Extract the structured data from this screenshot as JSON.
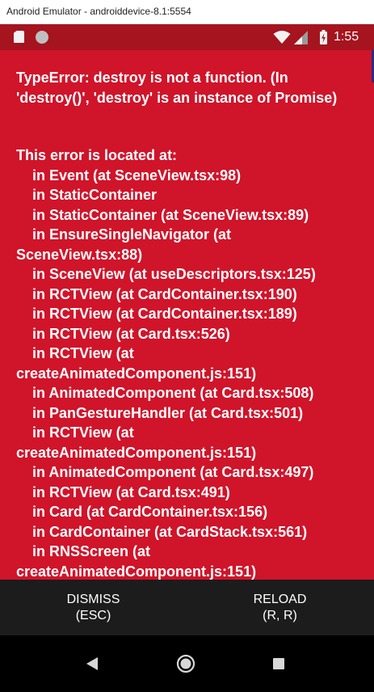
{
  "window": {
    "title": "Android Emulator - androiddevice-8.1:5554"
  },
  "status_bar": {
    "time": "1:55",
    "icons": [
      "sd-card-icon",
      "sync-dot-icon",
      "wifi-icon",
      "cell-signal-icon",
      "battery-charging-icon"
    ],
    "background_color": "#a5141f"
  },
  "redbox": {
    "background_color": "#d0142a",
    "error_message": "TypeError: destroy is not a function. (In 'destroy()', 'destroy' is an instance of Promise)",
    "stack_heading": "This error is located at:",
    "stack_lines": [
      {
        "text": "in Event (at SceneView.tsx:98)",
        "indent": true
      },
      {
        "text": "in StaticContainer",
        "indent": true
      },
      {
        "text": "in StaticContainer (at SceneView.tsx:89)",
        "indent": true
      },
      {
        "text": "in EnsureSingleNavigator (at",
        "indent": true
      },
      {
        "text": "SceneView.tsx:88)",
        "indent": false
      },
      {
        "text": "in SceneView (at useDescriptors.tsx:125)",
        "indent": true
      },
      {
        "text": "in RCTView (at CardContainer.tsx:190)",
        "indent": true
      },
      {
        "text": "in RCTView (at CardContainer.tsx:189)",
        "indent": true
      },
      {
        "text": "in RCTView (at Card.tsx:526)",
        "indent": true
      },
      {
        "text": "in RCTView (at",
        "indent": true
      },
      {
        "text": "createAnimatedComponent.js:151)",
        "indent": false
      },
      {
        "text": "in AnimatedComponent (at Card.tsx:508)",
        "indent": true
      },
      {
        "text": "in PanGestureHandler (at Card.tsx:501)",
        "indent": true
      },
      {
        "text": "in RCTView (at",
        "indent": true
      },
      {
        "text": "createAnimatedComponent.js:151)",
        "indent": false
      },
      {
        "text": "in AnimatedComponent (at Card.tsx:497)",
        "indent": true
      },
      {
        "text": "in RCTView (at Card.tsx:491)",
        "indent": true
      },
      {
        "text": "in Card (at CardContainer.tsx:156)",
        "indent": true
      },
      {
        "text": "in CardContainer (at CardStack.tsx:561)",
        "indent": true
      },
      {
        "text": "in RNSScreen (at",
        "indent": true
      },
      {
        "text": "createAnimatedComponent.js:151)",
        "indent": false
      }
    ]
  },
  "buttons": {
    "dismiss": {
      "label": "DISMISS",
      "shortcut": "(ESC)"
    },
    "reload": {
      "label": "RELOAD",
      "shortcut": "(R, R)"
    }
  },
  "nav_bar": {
    "icons": [
      "back-icon",
      "home-icon",
      "recents-icon"
    ]
  }
}
